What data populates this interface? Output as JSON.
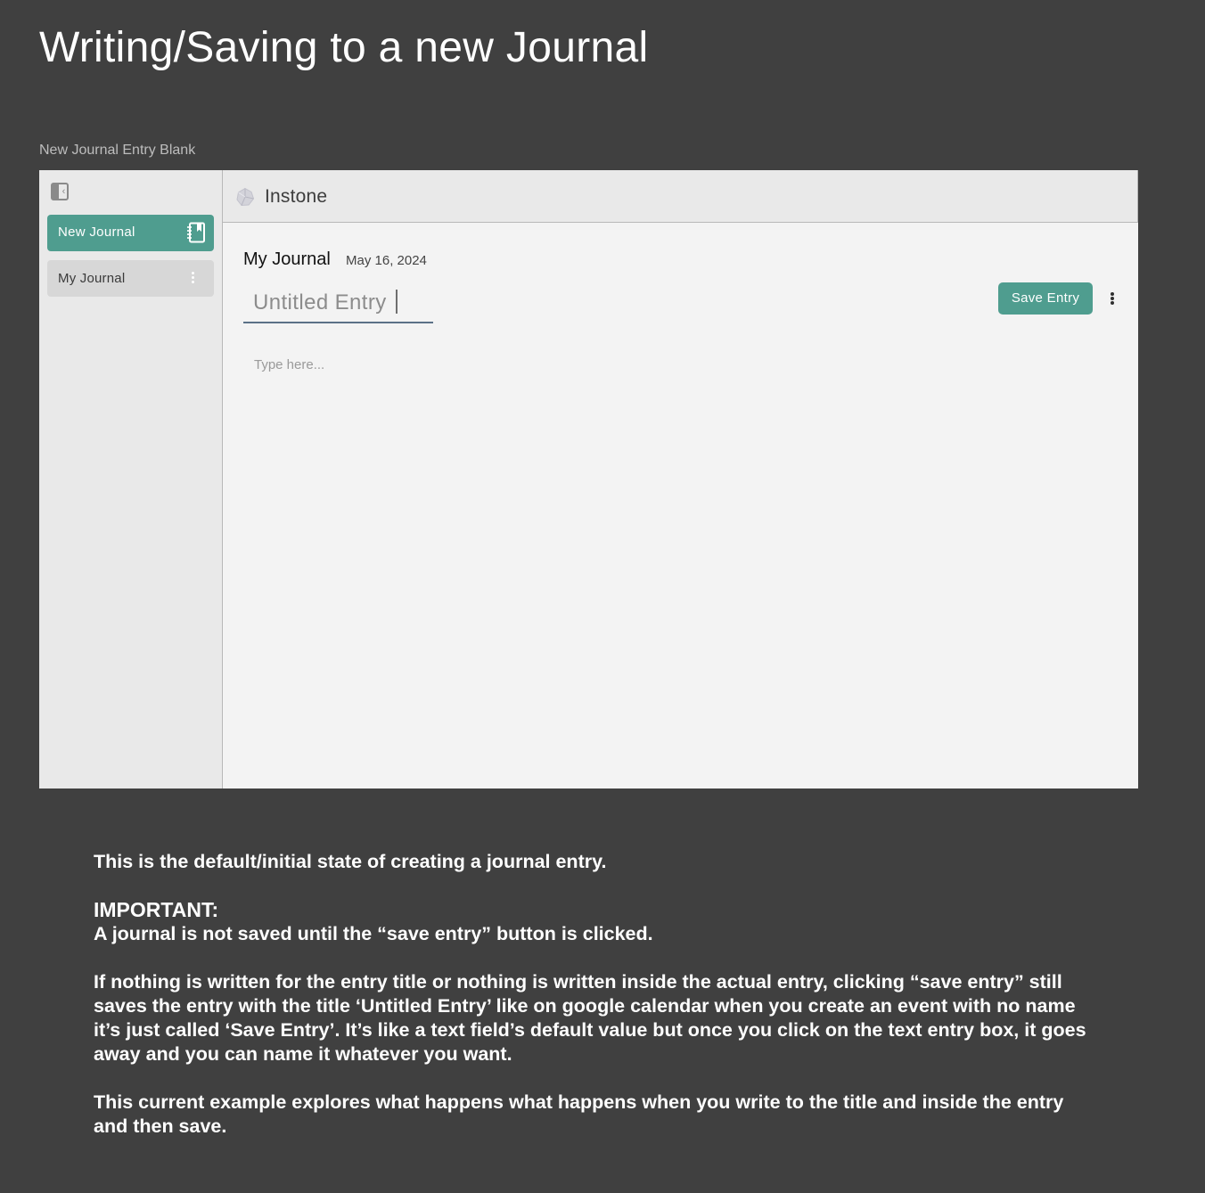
{
  "page": {
    "title": "Writing/Saving to a new Journal",
    "frame_label": "New Journal Entry Blank"
  },
  "sidebar": {
    "collapse_icon": "sidebar-collapse-icon",
    "new_journal_label": "New Journal",
    "new_journal_icon": "notebook-icon",
    "journals": [
      {
        "label": "My Journal",
        "menu_icon": "kebab-menu-icon"
      }
    ]
  },
  "topbar": {
    "app_name": "Instone",
    "logo_icon": "instone-logo-icon"
  },
  "editor": {
    "journal_name": "My Journal",
    "date": "May 16, 2024",
    "title_value": "Untitled Entry",
    "body_placeholder": "Type here...",
    "save_label": "Save Entry",
    "more_icon": "kebab-menu-icon"
  },
  "notes": {
    "line1": "This is the default/initial state of creating a journal entry.",
    "important_heading": "IMPORTANT:",
    "important_text": "A journal is not saved until the “save entry” button is clicked.",
    "paragraph2": "If nothing is written for the entry title or nothing is written inside the actual entry, clicking “save entry” still saves the entry with the title ‘Untitled Entry’ like on google calendar when you create an event with no name it’s just called ‘Save Entry’.  It’s like a text field’s default value but once you click on the text entry box, it goes away and you can name it whatever you want.",
    "paragraph3": "This current example explores what happens what happens when you write to the title and inside the entry and then save."
  },
  "colors": {
    "background": "#404040",
    "accent": "#4f9d8f",
    "panel": "#f3f3f3",
    "sidebar": "#e9e9e9",
    "input_underline": "#5b7187"
  }
}
